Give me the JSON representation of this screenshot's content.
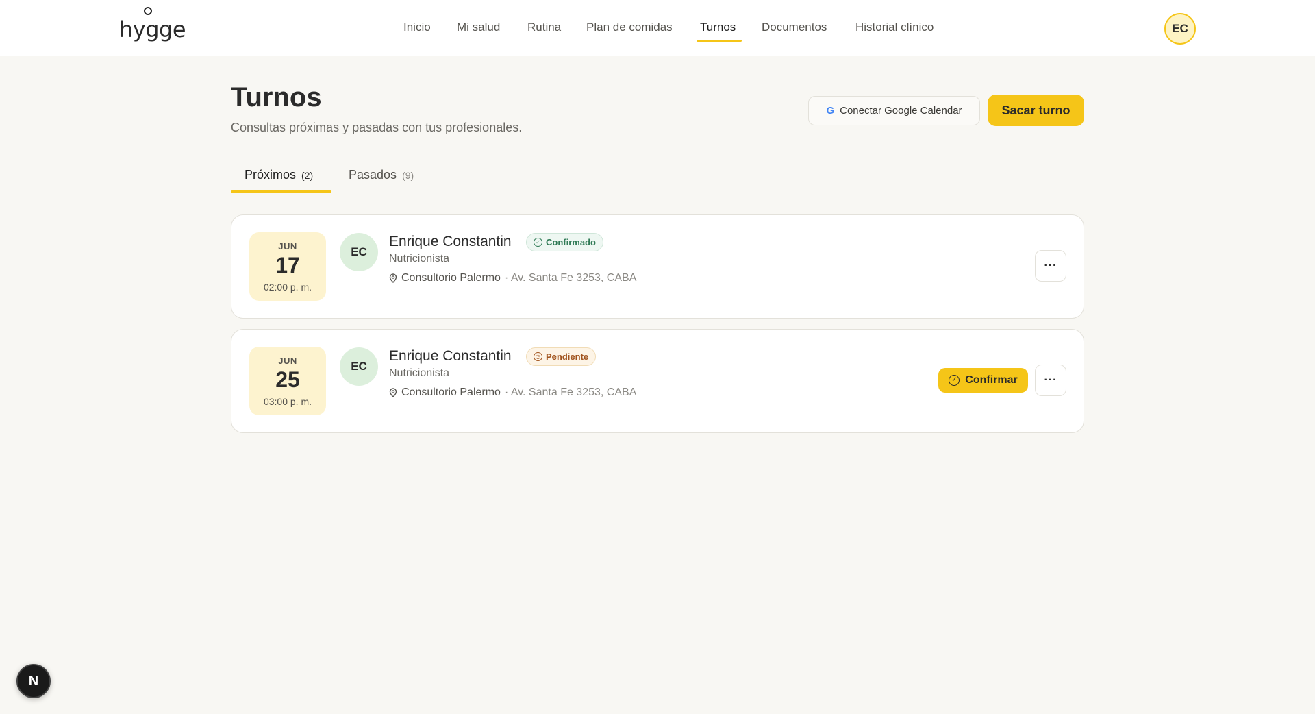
{
  "app": {
    "logo_text": "hygge"
  },
  "nav": {
    "items": [
      {
        "label": "Inicio"
      },
      {
        "label": "Mi salud"
      },
      {
        "label": "Rutina"
      },
      {
        "label": "Plan de comidas"
      },
      {
        "label": "Turnos",
        "active": true
      },
      {
        "label": "Documentos"
      },
      {
        "label": "Historial clínico"
      }
    ],
    "user_initials": "EC"
  },
  "page": {
    "title": "Turnos",
    "subtitle": "Consultas próximas y pasadas con tus profesionales.",
    "gcal_label": "Conectar Google Calendar",
    "gcal_icon": "G",
    "new_label": "Sacar turno"
  },
  "tabs": [
    {
      "label": "Próximos",
      "count": "(2)",
      "active": true
    },
    {
      "label": "Pasados",
      "count": "(9)",
      "active": false
    }
  ],
  "appointments": [
    {
      "month": "JUN",
      "day": "17",
      "time": "02:00 p. m.",
      "initials": "EC",
      "name": "Enrique Constantin",
      "status": "Confirmado",
      "role": "Nutricionista",
      "place": "Consultorio Palermo",
      "address": "· Av. Santa Fe 3253, CABA"
    },
    {
      "month": "JUN",
      "day": "25",
      "time": "03:00 p. m.",
      "initials": "EC",
      "name": "Enrique Constantin",
      "status": "Pendiente",
      "role": "Nutricionista",
      "place": "Consultorio Palermo",
      "address": "· Av. Santa Fe 3253, CABA",
      "confirm_label": "Confirmar"
    }
  ],
  "dev_badge": "N",
  "colors": {
    "accent": "#f5c518",
    "success": "#2f7a55",
    "warning": "#a0521c"
  }
}
